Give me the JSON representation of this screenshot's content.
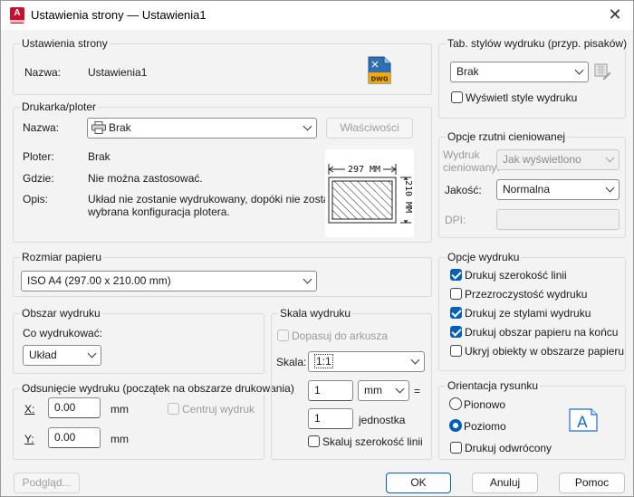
{
  "window": {
    "title": "Ustawienia strony — Ustawienia1",
    "app_icon_letter": "A"
  },
  "page_setup": {
    "legend": "Ustawienia strony",
    "name_label": "Nazwa:",
    "name_value": "Ustawienia1",
    "dwg_label": "DWG"
  },
  "printer": {
    "legend": "Drukarka/ploter",
    "name_label": "Nazwa:",
    "name_value": "Brak",
    "properties_button": "Właściwości",
    "plotter_label": "Ploter:",
    "plotter_value": "Brak",
    "where_label": "Gdzie:",
    "where_value": "Nie można zastosować.",
    "desc_label": "Opis:",
    "desc_value_1": "Układ nie zostanie wydrukowany, dopóki nie zostanie",
    "desc_value_2": "wybrana konfiguracja plotera.",
    "preview_width": "297 MM",
    "preview_height": "210 MM"
  },
  "paper_size": {
    "legend": "Rozmiar papieru",
    "value": "ISO A4 (297.00 x 210.00 mm)"
  },
  "plot_area": {
    "legend": "Obszar wydruku",
    "what_label": "Co wydrukować:",
    "what_value": "Układ"
  },
  "plot_offset": {
    "legend": "Odsunięcie wydruku (początek na obszarze drukowania)",
    "x_label": "X:",
    "x_value": "0.00",
    "x_unit": "mm",
    "y_label": "Y:",
    "y_value": "0.00",
    "y_unit": "mm",
    "center_label": "Centruj wydruk"
  },
  "plot_scale": {
    "legend": "Skala wydruku",
    "fit_label": "Dopasuj do arkusza",
    "scale_label": "Skala:",
    "scale_value": "1:1",
    "value1": "1",
    "unit_value": "mm",
    "equals": "=",
    "value2": "1",
    "unit2_label": "jednostka",
    "scale_lineweights_label": "Skaluj szerokość linii"
  },
  "plot_style_table": {
    "legend": "Tab. stylów wydruku (przyp. pisaków)",
    "value": "Brak",
    "display_label": "Wyświetl style wydruku"
  },
  "shaded_viewport": {
    "legend": "Opcje rzutni cieniowanej",
    "shade_label_1": "Wydruk",
    "shade_label_2": "cieniowany:",
    "shade_value": "Jak wyświetlono",
    "quality_label": "Jakość:",
    "quality_value": "Normalna",
    "dpi_label": "DPI:"
  },
  "plot_options": {
    "legend": "Opcje wydruku",
    "items": [
      {
        "label": "Drukuj szerokość linii",
        "checked": true
      },
      {
        "label": "Przezroczystość wydruku",
        "checked": false
      },
      {
        "label": "Drukuj ze stylami wydruku",
        "checked": true
      },
      {
        "label": "Drukuj obszar papieru na końcu",
        "checked": true
      },
      {
        "label": "Ukryj obiekty w obszarze papieru",
        "checked": false
      }
    ]
  },
  "orientation": {
    "legend": "Orientacja rysunku",
    "portrait_label": "Pionowo",
    "landscape_label": "Poziomo",
    "upside_down_label": "Drukuj odwrócony",
    "icon_letter": "A"
  },
  "footer": {
    "preview_button": "Podgląd...",
    "ok_button": "OK",
    "cancel_button": "Anuluj",
    "help_button": "Pomoc"
  }
}
